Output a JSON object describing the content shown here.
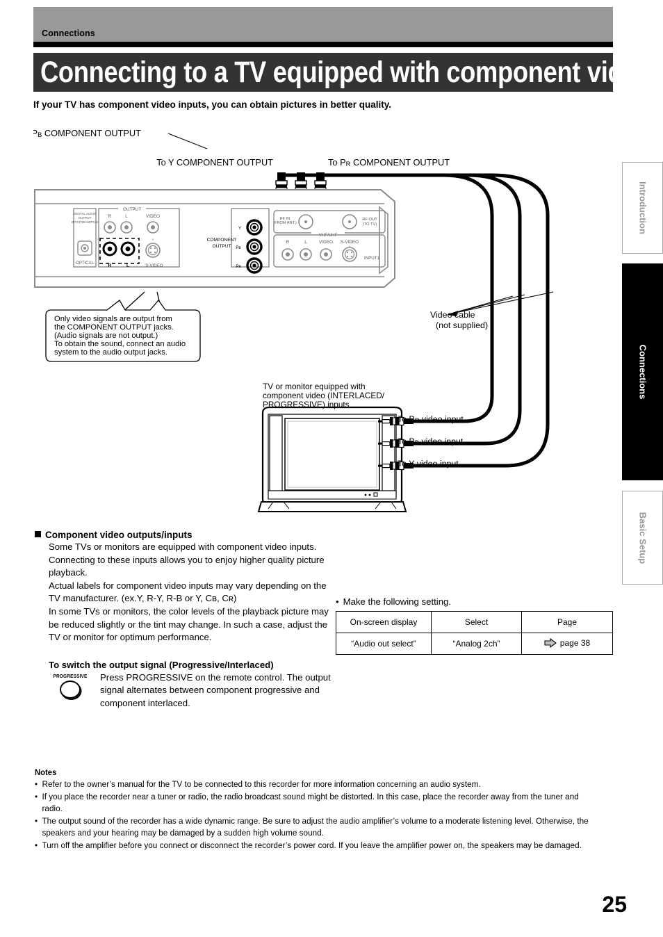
{
  "header": {
    "section_label": "Connections",
    "title": "Connecting to a TV equipped with component video inputs",
    "subtitle": "If your TV has component video inputs, you can obtain pictures in better quality."
  },
  "sidebar": {
    "tabs": [
      {
        "label": "Introduction",
        "active": false
      },
      {
        "label": "Connections",
        "active": true
      },
      {
        "label": "Basic Setup",
        "active": false
      }
    ]
  },
  "diagram": {
    "labels": {
      "to_pb_output": "To Pʙ COMPONENT OUTPUT",
      "to_y_output": "To Y COMPONENT OUTPUT",
      "to_pr_output": "To Pʀ COMPONENT OUTPUT",
      "video_cable_1": "Video cable",
      "video_cable_2": "(not supplied)",
      "tv_caption_1": "TV or monitor equipped with",
      "tv_caption_2": "component video (INTERLACED/",
      "tv_caption_3": "PROGRESSIVE) inputs",
      "to_pr_input": "To Pʀ video input",
      "to_pb_input": "To Pʙ video input",
      "to_y_input": "To Y video input"
    },
    "callout": [
      "Only video signals are output from",
      "the COMPONENT OUTPUT jacks.",
      "(Audio signals are not output.)",
      "To obtain the sound, connect an audio",
      "system to the audio output jacks."
    ],
    "rear_panel": {
      "digital_audio": [
        "DIGITAL AUDIO",
        "OUTPUT",
        "BITSTREAM/PCM"
      ],
      "optical": "OPTICAL",
      "output_group": "OUTPUT",
      "out_r": "R",
      "out_l": "L",
      "out_video": "VIDEO",
      "out_r2": "R",
      "out_l2": "L",
      "s_video": "S-VIDEO",
      "component_output_1": "COMPONENT",
      "component_output_2": "OUTPUT",
      "comp_y": "Y",
      "comp_pb": "Pʙ",
      "comp_pr": "Pʀ",
      "rf_in_1": "RF IN",
      "rf_in_2": "(FROM ANT.)",
      "rf_out_1": "RF OUT",
      "rf_out_2": "(TO TV)",
      "vhf_uhf": "VHF/UHF",
      "in_r": "R",
      "in_l": "L",
      "in_video": "VIDEO",
      "in_svideo": "S-VIDEO",
      "input1": "INPUT1"
    }
  },
  "main": {
    "section_heading": "Component video outputs/inputs",
    "paragraphs": [
      "Some TVs or monitors are equipped with component video inputs.  Connecting to these inputs allows you to enjoy higher quality picture playback.",
      "Actual labels for component video inputs may vary depending on the TV manufacturer. (ex.Y, R-Y, R-B or Y, Cʙ, Cʀ)",
      "In some TVs or monitors, the color levels of the playback picture may be reduced slightly or the tint may change. In such a case, adjust the TV or monitor for optimum performance."
    ],
    "switch_heading": "To switch the output signal (Progressive/Interlaced)",
    "progressive_button_label": "PROGRESSIVE",
    "switch_text": "Press PROGRESSIVE on the remote control. The output signal alternates between component progressive and component interlaced."
  },
  "setting": {
    "intro": "Make the following setting.",
    "bullet": "•",
    "columns": [
      "On-screen display",
      "Select",
      "Page"
    ],
    "rows": [
      {
        "on_screen_display": "“Audio out select”",
        "select": "“Analog 2ch”",
        "page": "page 38"
      }
    ]
  },
  "notes": {
    "heading": "Notes",
    "items": [
      "Refer to the owner’s manual for the TV to be connected to this recorder for more information concerning an audio system.",
      "If you place the recorder near a tuner or radio, the radio broadcast sound might be distorted. In this case, place the recorder away from the tuner and radio.",
      "The output sound of the recorder has a wide dynamic range. Be sure to adjust the audio amplifier’s volume to a moderate listening level. Otherwise, the speakers and your hearing may be damaged by a sudden high volume sound.",
      "Turn off the amplifier before you connect or disconnect the recorder’s power cord. If you leave the amplifier power on, the speakers may be damaged."
    ]
  },
  "footer": {
    "page_number": "25"
  },
  "colors": {
    "header_band": "#999999",
    "title_band": "#333333",
    "rule": "#000000",
    "tab_inactive_text": "#999999",
    "tab_active_bg": "#000000"
  }
}
